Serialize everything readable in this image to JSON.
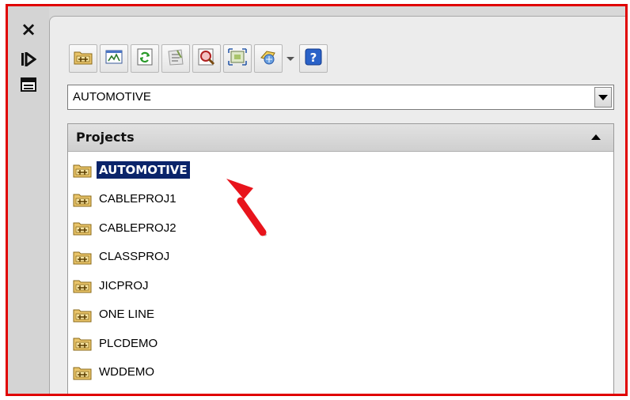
{
  "palette": {
    "frame_border": "#e00000",
    "selection_bg": "#0a246a",
    "selection_text": "#ffffff",
    "annotation_arrow": "#e8141c"
  },
  "left_toolbar": [
    {
      "name": "close-icon",
      "icon": "close-icon"
    },
    {
      "name": "auto-hide-icon",
      "icon": "auto-hide-icon"
    },
    {
      "name": "properties-icon",
      "icon": "properties-icon"
    }
  ],
  "toolbar": {
    "buttons": [
      {
        "icon": "open-project-icon"
      },
      {
        "icon": "new-project-icon"
      },
      {
        "icon": "refresh-icon"
      },
      {
        "icon": "task-list-icon"
      },
      {
        "icon": "project-wide-update-icon"
      },
      {
        "icon": "project-wide-reports-icon"
      },
      {
        "icon": "plot-project-icon"
      },
      {
        "icon": "help-icon"
      }
    ]
  },
  "project_selector": {
    "value": "AUTOMOTIVE"
  },
  "projects": {
    "header": "Projects",
    "items": [
      {
        "label": "AUTOMOTIVE",
        "selected": true
      },
      {
        "label": "CABLEPROJ1",
        "selected": false
      },
      {
        "label": "CABLEPROJ2",
        "selected": false
      },
      {
        "label": "CLASSPROJ",
        "selected": false
      },
      {
        "label": "JICPROJ",
        "selected": false
      },
      {
        "label": "ONE LINE",
        "selected": false
      },
      {
        "label": "PLCDEMO",
        "selected": false
      },
      {
        "label": "WDDEMO",
        "selected": false
      }
    ]
  },
  "annotation": {
    "icon": "red-pointer-arrow"
  }
}
